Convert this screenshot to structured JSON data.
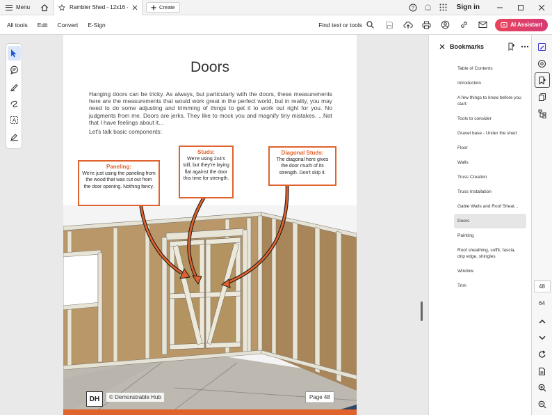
{
  "titlebar": {
    "menu_label": "Menu",
    "tab_title": "Rambler Shed - 12x16 - ...",
    "create_label": "Create",
    "signin_label": "Sign in"
  },
  "toolbar": {
    "items": [
      "All tools",
      "Edit",
      "Convert",
      "E-Sign"
    ],
    "find_label": "Find text or tools",
    "ai_label": "AI Assistant",
    "ai_color": "#e8455c"
  },
  "document": {
    "title": "Doors",
    "paragraph": "Hanging doors can be tricky.  As always, but particularly with the doors, these measurements here are the measurements that would work great in the perfect world, but in reality, you may need to do some adjusting and trimming of things to get it to work out right for you.  No judgments from me. Doors are jerks. They like to mock you and magnify tiny mistakes. ...Not that I have feelings about it...",
    "intro": "Let's talk basic components:",
    "callouts": {
      "paneling": {
        "title": "Paneling:",
        "body": "We're just using the paneling from the wood that was cut out from the door opening. Nothing fancy."
      },
      "studs": {
        "title": "Studs:",
        "body": "We're using 2x4's still, but they're laying flat against the door this time for strength."
      },
      "diagonal": {
        "title": "Diagonal Studs:",
        "body": "The diagonal here gives the door much of its strength. Don't skip it."
      }
    },
    "logo_text": "DH",
    "brand": "© Demonstrable Hub",
    "page_label": "Page 48",
    "accent_color": "#e0622c"
  },
  "bookmarks": {
    "title": "Bookmarks",
    "items": [
      "Table of Contents",
      "Introduction",
      "A few things to know before you start:",
      "Tools to consider",
      "Gravel base - Under the shed",
      "Floor",
      "Walls",
      "Truss Creation",
      "Truss Installation",
      "Gable Walls and Roof Sheat...",
      "Doors",
      "Painting",
      "Roof sheathing, soffit, fascia, drip edge, shingles",
      "Window",
      "Trim"
    ],
    "active_index": 10
  },
  "rail": {
    "current_page": "48",
    "total_pages": "64"
  }
}
